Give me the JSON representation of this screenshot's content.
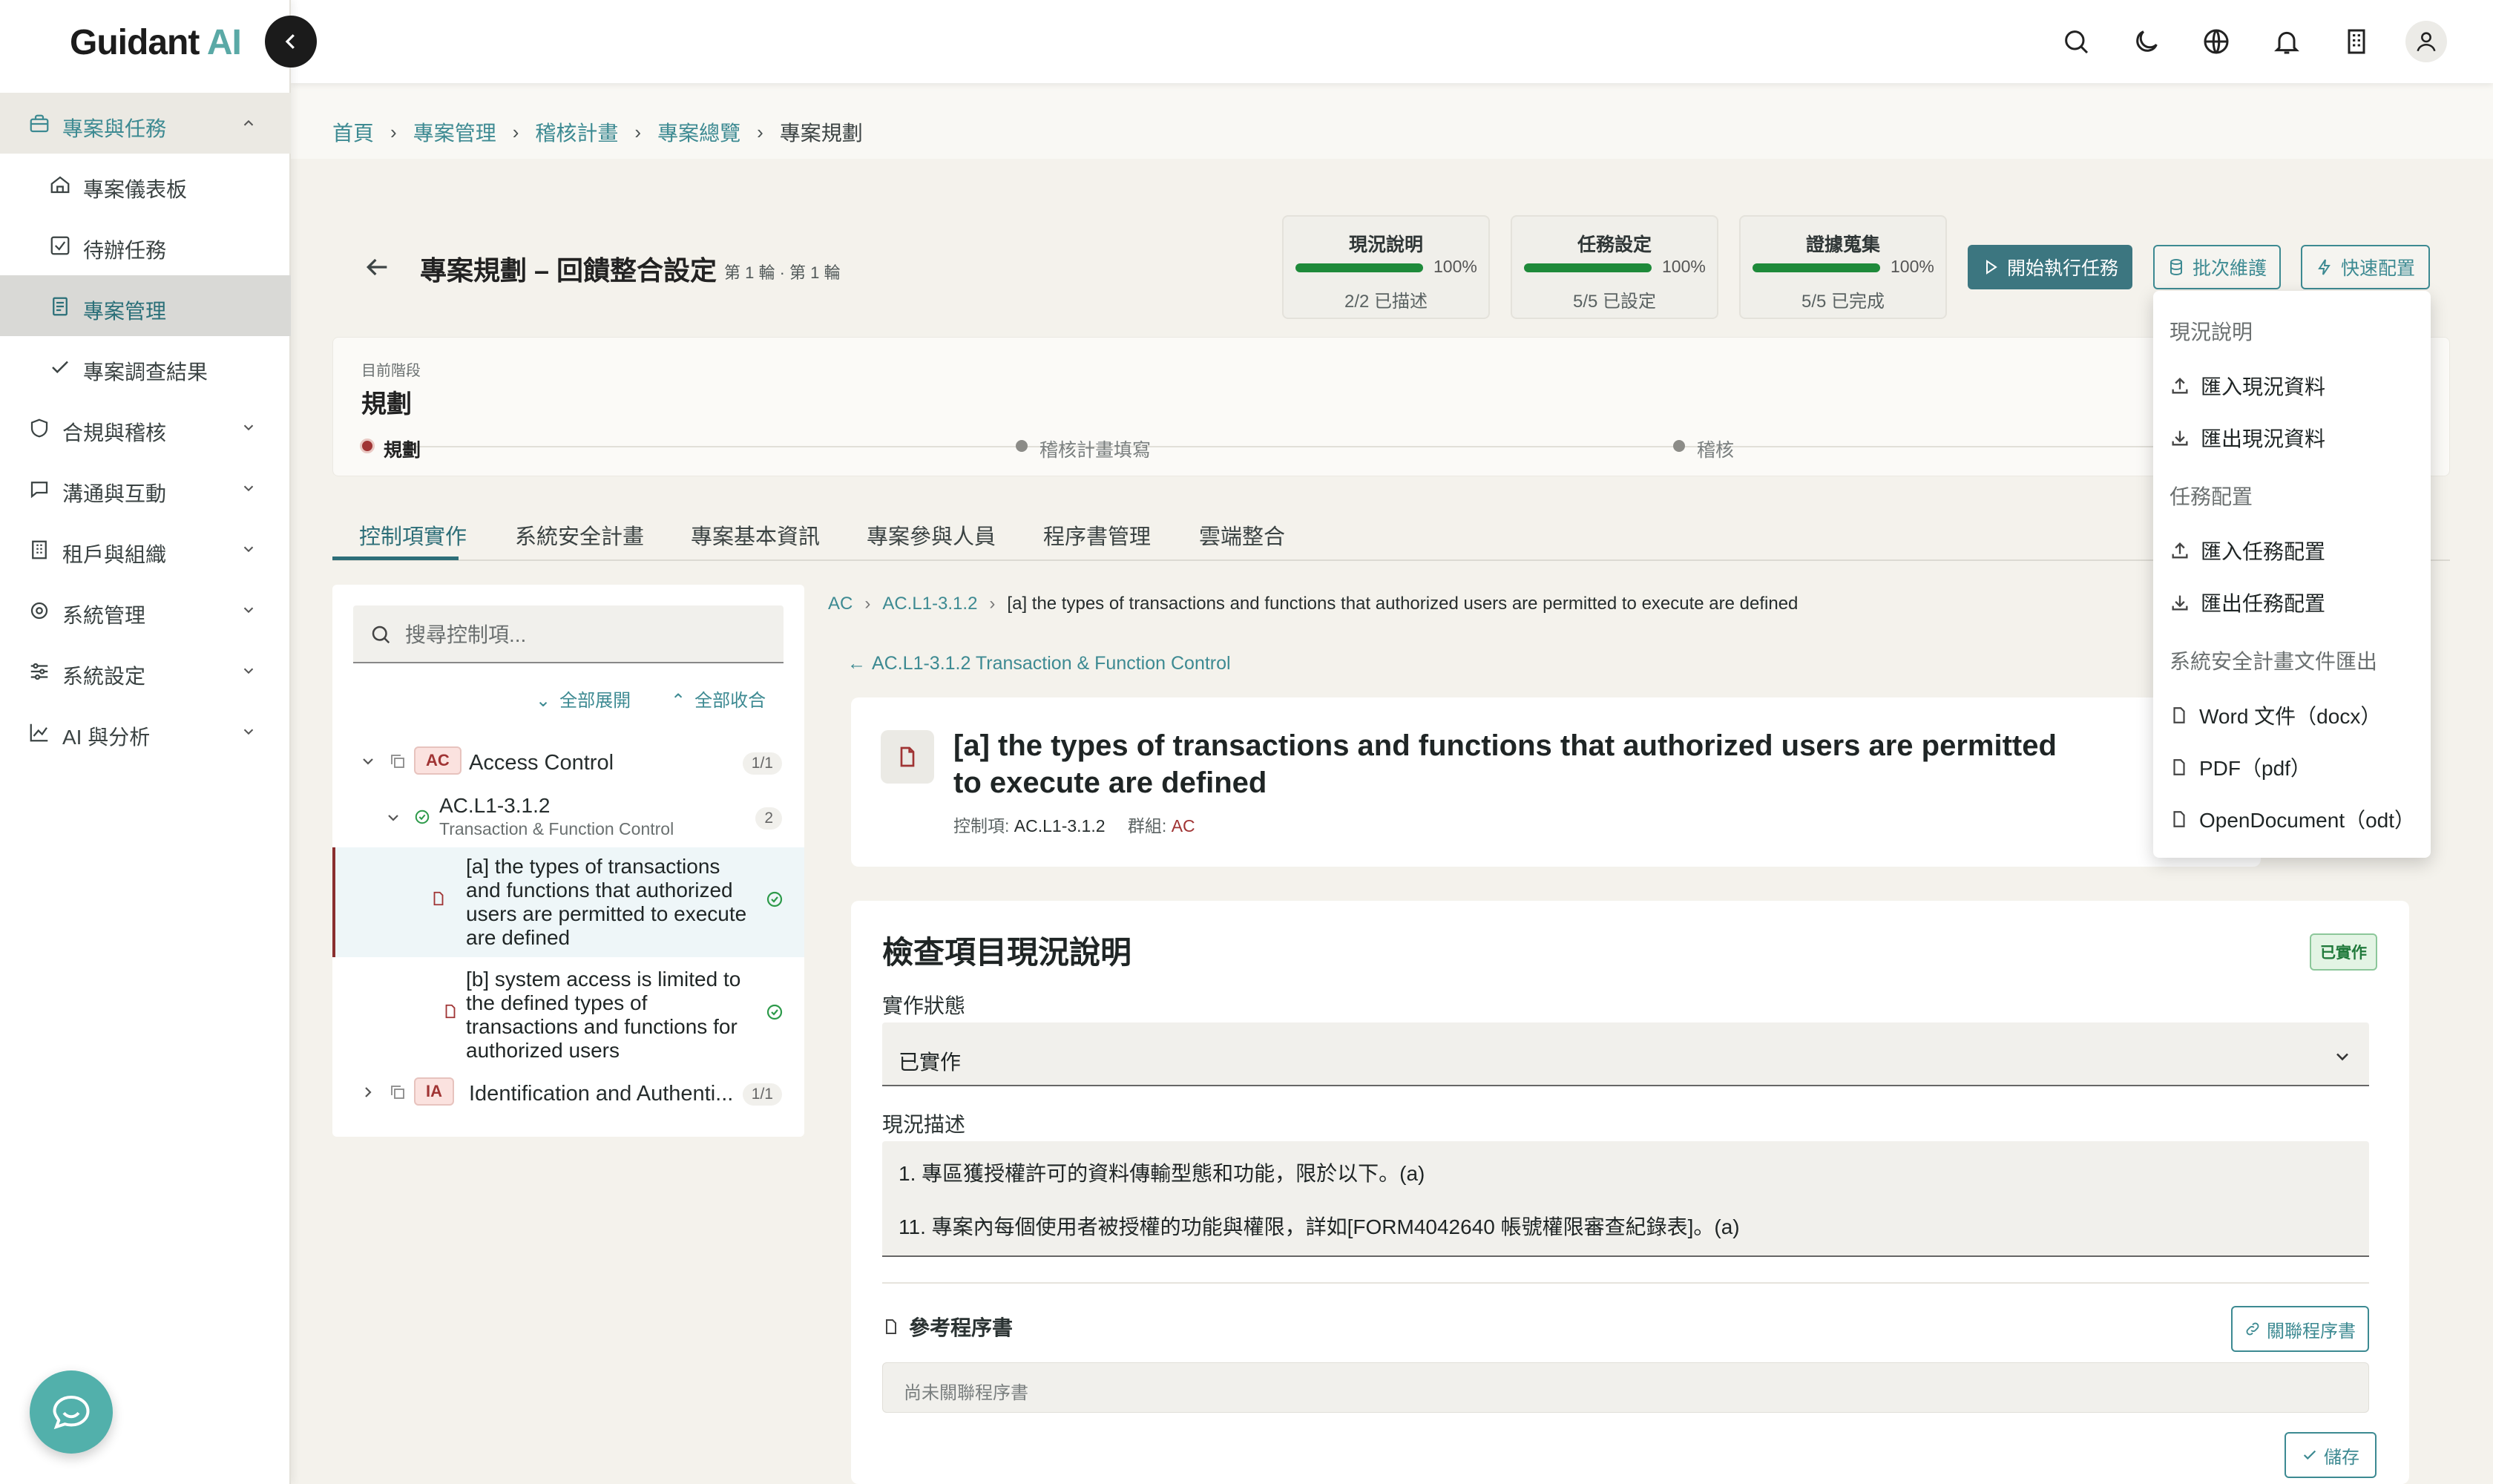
{
  "brand": {
    "name": "Guidant",
    "suffix": "AI"
  },
  "sidebar": {
    "items": [
      {
        "label": "專案與任務",
        "icon": "briefcase-icon"
      },
      {
        "label": "專案儀表板",
        "icon": "home-icon"
      },
      {
        "label": "待辦任務",
        "icon": "checkbox-icon"
      },
      {
        "label": "專案管理",
        "icon": "document-icon"
      },
      {
        "label": "專案調查結果",
        "icon": "check-icon"
      },
      {
        "label": "合規與稽核",
        "icon": "shield-icon"
      },
      {
        "label": "溝通與互動",
        "icon": "chat-icon"
      },
      {
        "label": "租戶與組織",
        "icon": "building-icon"
      },
      {
        "label": "系統管理",
        "icon": "gear-icon"
      },
      {
        "label": "系統設定",
        "icon": "sliders-icon"
      },
      {
        "label": "AI 與分析",
        "icon": "chart-icon"
      }
    ]
  },
  "breadcrumb": [
    "首頁",
    "專案管理",
    "稽核計畫",
    "專案總覽",
    "專案規劃"
  ],
  "header": {
    "title": "專案規劃 – 回饋整合設定",
    "subtitle": "第 1 輪 · 第 1 輪",
    "stats": [
      {
        "title": "現況說明",
        "percent": "100%",
        "progress": 1.0,
        "sub": "2/2 已描述"
      },
      {
        "title": "任務設定",
        "percent": "100%",
        "progress": 1.0,
        "sub": "5/5 已設定"
      },
      {
        "title": "證據蒐集",
        "percent": "100%",
        "progress": 1.0,
        "sub": "5/5 已完成"
      }
    ],
    "start_label": "開始執行任務",
    "batch_label": "批次維護",
    "quick_label": "快速配置"
  },
  "stage": {
    "label": "目前階段",
    "value": "規劃",
    "steps": [
      "規劃",
      "稽核計畫填寫",
      "稽核"
    ]
  },
  "tabs": [
    "控制項實作",
    "系統安全計畫",
    "專案基本資訊",
    "專案參與人員",
    "程序書管理",
    "雲端整合"
  ],
  "tree": {
    "search_placeholder": "搜尋控制項...",
    "expand_all": "全部展開",
    "collapse_all": "全部收合",
    "groups": [
      {
        "badge": "AC",
        "name": "Access Control",
        "count": "1/1"
      },
      {
        "badge": "IA",
        "name": "Identification and Authenti...",
        "count": "1/1"
      }
    ],
    "control": {
      "id": "AC.L1-3.1.2",
      "name": "Transaction & Function Control",
      "count": "2"
    },
    "objectives": [
      {
        "lines": [
          "[a] the types of transactions",
          "and functions that authorized",
          "users are permitted to execute",
          "are defined"
        ]
      },
      {
        "lines": [
          "[b] system access is limited to",
          "the defined types of",
          "transactions and functions for",
          "authorized users"
        ]
      }
    ]
  },
  "detail": {
    "crumbs": [
      "AC",
      "AC.L1-3.1.2",
      "[a] the types of transactions and functions that authorized users are permitted to execute are defined"
    ],
    "back_label": "AC.L1-3.1.2 Transaction & Function Control",
    "title": "[a] the types of transactions and functions that authorized users are permitted to execute are defined",
    "meta_control_label": "控制項:",
    "meta_control": "AC.L1-3.1.2",
    "meta_group_label": "群組:",
    "meta_group": "AC"
  },
  "form": {
    "title": "檢查項目現況說明",
    "badge": "已實作",
    "status_label": "實作狀態",
    "status_value": "已實作",
    "desc_label": "現況描述",
    "desc_lines": [
      "1. 專區獲授權許可的資料傳輸型態和功能，限於以下。(a)",
      "11. 專案內每個使用者被授權的功能與權限，詳如[FORM4042640 帳號權限審查紀錄表]。(a)"
    ],
    "ref_label": "參考程序書",
    "link_btn": "關聯程序書",
    "empty": "尚未關聯程序書",
    "save": "儲存"
  },
  "menu": {
    "sections": [
      {
        "heading": "現況說明",
        "items": [
          "匯入現況資料",
          "匯出現況資料"
        ]
      },
      {
        "heading": "任務配置",
        "items": [
          "匯入任務配置",
          "匯出任務配置"
        ]
      },
      {
        "heading": "系統安全計畫文件匯出",
        "items": [
          "Word 文件（docx）",
          "PDF（pdf）",
          "OpenDocument（odt）"
        ]
      }
    ]
  },
  "colors": {
    "accent": "#3d8a92",
    "progress": "#1e8a3a",
    "badge_red": "#a03434"
  }
}
